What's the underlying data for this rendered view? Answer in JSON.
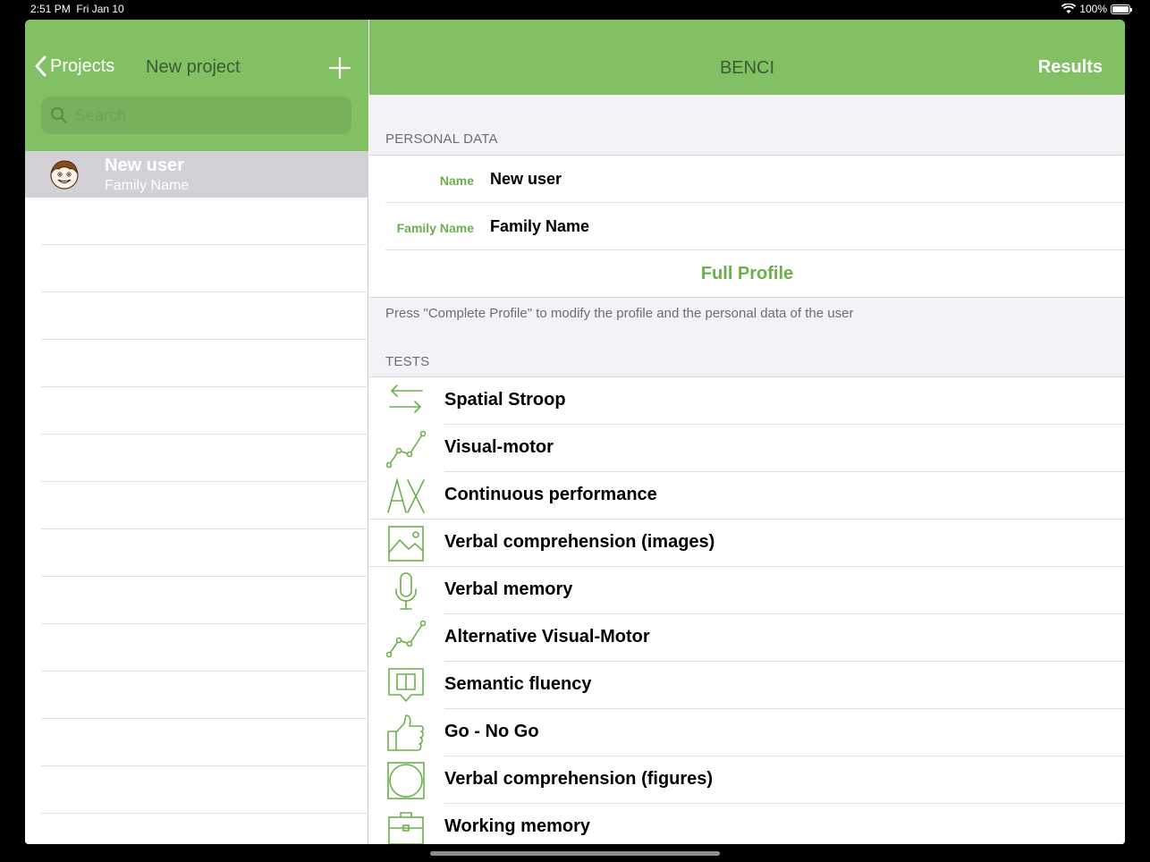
{
  "status": {
    "time": "2:51 PM",
    "date": "Fri Jan 10",
    "battery": "100%"
  },
  "master": {
    "back_label": "Projects",
    "title": "New project",
    "search_placeholder": "Search",
    "users": [
      {
        "name": "New user",
        "family": "Family Name"
      }
    ]
  },
  "detail": {
    "title": "BENCI",
    "results_label": "Results",
    "personal_header": "PERSONAL DATA",
    "name_label": "Name",
    "name_value": "New user",
    "family_label": "Family Name",
    "family_value": "Family Name",
    "full_profile": "Full Profile",
    "hint": "Press \"Complete Profile\" to modify the profile and the personal data of the user",
    "tests_header": "TESTS",
    "tests": [
      {
        "label": "Spatial Stroop",
        "icon": "arrows-swap-icon"
      },
      {
        "label": "Visual-motor",
        "icon": "line-graph-icon"
      },
      {
        "label": "Continuous performance",
        "icon": "ax-icon"
      },
      {
        "label": "Verbal comprehension (images)",
        "icon": "image-icon"
      },
      {
        "label": "Verbal memory",
        "icon": "microphone-icon"
      },
      {
        "label": "Alternative Visual-Motor",
        "icon": "line-graph-icon"
      },
      {
        "label": "Semantic fluency",
        "icon": "book-bubble-icon"
      },
      {
        "label": "Go - No Go",
        "icon": "thumbs-up-icon"
      },
      {
        "label": "Verbal comprehension (figures)",
        "icon": "circle-square-icon"
      },
      {
        "label": "Working memory",
        "icon": "briefcase-icon"
      }
    ]
  },
  "colors": {
    "accent": "#82c064",
    "label_green": "#6bb04c",
    "title_dark": "#3e5a30"
  }
}
